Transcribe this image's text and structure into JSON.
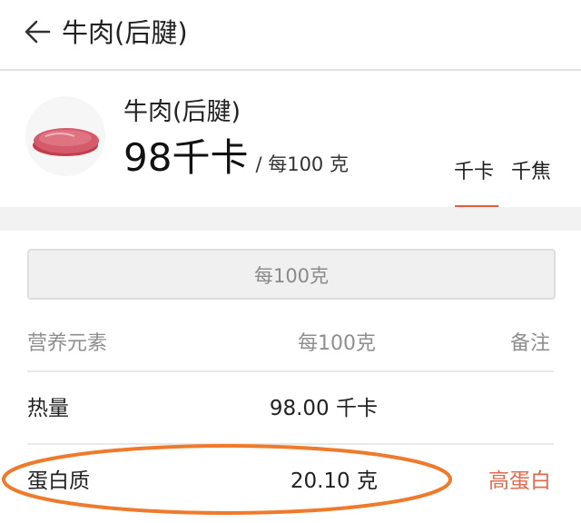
{
  "topbar": {
    "back_icon": "arrow-left-icon",
    "title": "牛肉(后腱)"
  },
  "food": {
    "name": "牛肉(后腱)",
    "energy_value": "98千卡",
    "energy_unit": "/ 每100 克",
    "image_icon": "raw-beef-icon"
  },
  "unit_tabs": [
    {
      "label": "千卡",
      "selected": true
    },
    {
      "label": "千焦",
      "selected": false
    }
  ],
  "basis_button": {
    "label": "每100克"
  },
  "table": {
    "headers": [
      "营养元素",
      "每100克",
      "备注"
    ],
    "rows": [
      {
        "name": "热量",
        "value": "98.00 千卡",
        "note": ""
      },
      {
        "name": "蛋白质",
        "value": "20.10 克",
        "note": "高蛋白"
      }
    ]
  },
  "colors": {
    "accent": "#e85a44",
    "note_text": "#e36a4e",
    "annotation_circle": "#ef7a2b"
  }
}
